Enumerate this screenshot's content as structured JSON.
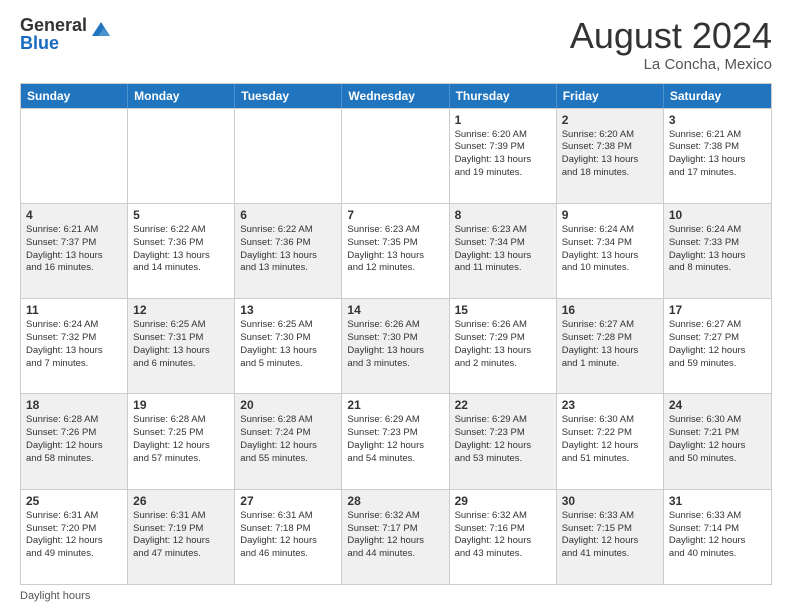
{
  "header": {
    "logo_general": "General",
    "logo_blue": "Blue",
    "main_title": "August 2024",
    "subtitle": "La Concha, Mexico"
  },
  "calendar": {
    "days_of_week": [
      "Sunday",
      "Monday",
      "Tuesday",
      "Wednesday",
      "Thursday",
      "Friday",
      "Saturday"
    ],
    "rows": [
      [
        {
          "day": "",
          "info": "",
          "shaded": false
        },
        {
          "day": "",
          "info": "",
          "shaded": false
        },
        {
          "day": "",
          "info": "",
          "shaded": false
        },
        {
          "day": "",
          "info": "",
          "shaded": false
        },
        {
          "day": "1",
          "info": "Sunrise: 6:20 AM\nSunset: 7:39 PM\nDaylight: 13 hours\nand 19 minutes.",
          "shaded": false
        },
        {
          "day": "2",
          "info": "Sunrise: 6:20 AM\nSunset: 7:38 PM\nDaylight: 13 hours\nand 18 minutes.",
          "shaded": true
        },
        {
          "day": "3",
          "info": "Sunrise: 6:21 AM\nSunset: 7:38 PM\nDaylight: 13 hours\nand 17 minutes.",
          "shaded": false
        }
      ],
      [
        {
          "day": "4",
          "info": "Sunrise: 6:21 AM\nSunset: 7:37 PM\nDaylight: 13 hours\nand 16 minutes.",
          "shaded": true
        },
        {
          "day": "5",
          "info": "Sunrise: 6:22 AM\nSunset: 7:36 PM\nDaylight: 13 hours\nand 14 minutes.",
          "shaded": false
        },
        {
          "day": "6",
          "info": "Sunrise: 6:22 AM\nSunset: 7:36 PM\nDaylight: 13 hours\nand 13 minutes.",
          "shaded": true
        },
        {
          "day": "7",
          "info": "Sunrise: 6:23 AM\nSunset: 7:35 PM\nDaylight: 13 hours\nand 12 minutes.",
          "shaded": false
        },
        {
          "day": "8",
          "info": "Sunrise: 6:23 AM\nSunset: 7:34 PM\nDaylight: 13 hours\nand 11 minutes.",
          "shaded": true
        },
        {
          "day": "9",
          "info": "Sunrise: 6:24 AM\nSunset: 7:34 PM\nDaylight: 13 hours\nand 10 minutes.",
          "shaded": false
        },
        {
          "day": "10",
          "info": "Sunrise: 6:24 AM\nSunset: 7:33 PM\nDaylight: 13 hours\nand 8 minutes.",
          "shaded": true
        }
      ],
      [
        {
          "day": "11",
          "info": "Sunrise: 6:24 AM\nSunset: 7:32 PM\nDaylight: 13 hours\nand 7 minutes.",
          "shaded": false
        },
        {
          "day": "12",
          "info": "Sunrise: 6:25 AM\nSunset: 7:31 PM\nDaylight: 13 hours\nand 6 minutes.",
          "shaded": true
        },
        {
          "day": "13",
          "info": "Sunrise: 6:25 AM\nSunset: 7:30 PM\nDaylight: 13 hours\nand 5 minutes.",
          "shaded": false
        },
        {
          "day": "14",
          "info": "Sunrise: 6:26 AM\nSunset: 7:30 PM\nDaylight: 13 hours\nand 3 minutes.",
          "shaded": true
        },
        {
          "day": "15",
          "info": "Sunrise: 6:26 AM\nSunset: 7:29 PM\nDaylight: 13 hours\nand 2 minutes.",
          "shaded": false
        },
        {
          "day": "16",
          "info": "Sunrise: 6:27 AM\nSunset: 7:28 PM\nDaylight: 13 hours\nand 1 minute.",
          "shaded": true
        },
        {
          "day": "17",
          "info": "Sunrise: 6:27 AM\nSunset: 7:27 PM\nDaylight: 12 hours\nand 59 minutes.",
          "shaded": false
        }
      ],
      [
        {
          "day": "18",
          "info": "Sunrise: 6:28 AM\nSunset: 7:26 PM\nDaylight: 12 hours\nand 58 minutes.",
          "shaded": true
        },
        {
          "day": "19",
          "info": "Sunrise: 6:28 AM\nSunset: 7:25 PM\nDaylight: 12 hours\nand 57 minutes.",
          "shaded": false
        },
        {
          "day": "20",
          "info": "Sunrise: 6:28 AM\nSunset: 7:24 PM\nDaylight: 12 hours\nand 55 minutes.",
          "shaded": true
        },
        {
          "day": "21",
          "info": "Sunrise: 6:29 AM\nSunset: 7:23 PM\nDaylight: 12 hours\nand 54 minutes.",
          "shaded": false
        },
        {
          "day": "22",
          "info": "Sunrise: 6:29 AM\nSunset: 7:23 PM\nDaylight: 12 hours\nand 53 minutes.",
          "shaded": true
        },
        {
          "day": "23",
          "info": "Sunrise: 6:30 AM\nSunset: 7:22 PM\nDaylight: 12 hours\nand 51 minutes.",
          "shaded": false
        },
        {
          "day": "24",
          "info": "Sunrise: 6:30 AM\nSunset: 7:21 PM\nDaylight: 12 hours\nand 50 minutes.",
          "shaded": true
        }
      ],
      [
        {
          "day": "25",
          "info": "Sunrise: 6:31 AM\nSunset: 7:20 PM\nDaylight: 12 hours\nand 49 minutes.",
          "shaded": false
        },
        {
          "day": "26",
          "info": "Sunrise: 6:31 AM\nSunset: 7:19 PM\nDaylight: 12 hours\nand 47 minutes.",
          "shaded": true
        },
        {
          "day": "27",
          "info": "Sunrise: 6:31 AM\nSunset: 7:18 PM\nDaylight: 12 hours\nand 46 minutes.",
          "shaded": false
        },
        {
          "day": "28",
          "info": "Sunrise: 6:32 AM\nSunset: 7:17 PM\nDaylight: 12 hours\nand 44 minutes.",
          "shaded": true
        },
        {
          "day": "29",
          "info": "Sunrise: 6:32 AM\nSunset: 7:16 PM\nDaylight: 12 hours\nand 43 minutes.",
          "shaded": false
        },
        {
          "day": "30",
          "info": "Sunrise: 6:33 AM\nSunset: 7:15 PM\nDaylight: 12 hours\nand 41 minutes.",
          "shaded": true
        },
        {
          "day": "31",
          "info": "Sunrise: 6:33 AM\nSunset: 7:14 PM\nDaylight: 12 hours\nand 40 minutes.",
          "shaded": false
        }
      ]
    ]
  },
  "footer": {
    "label": "Daylight hours"
  }
}
